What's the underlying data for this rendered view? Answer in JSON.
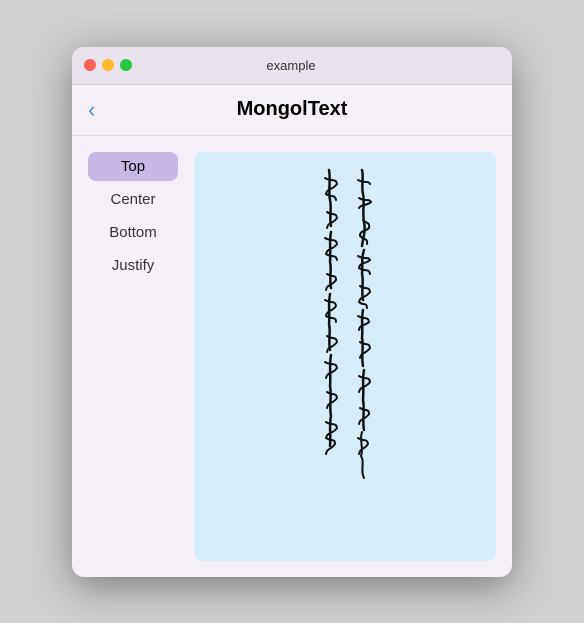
{
  "titlebar": {
    "title": "example"
  },
  "header": {
    "back_label": "‹",
    "title": "MongolText"
  },
  "sidebar": {
    "items": [
      {
        "label": "Top",
        "active": true
      },
      {
        "label": "Center",
        "active": false
      },
      {
        "label": "Bottom",
        "active": false
      },
      {
        "label": "Justify",
        "active": false
      }
    ]
  },
  "text_display": {
    "background": "#d6ecf8"
  }
}
